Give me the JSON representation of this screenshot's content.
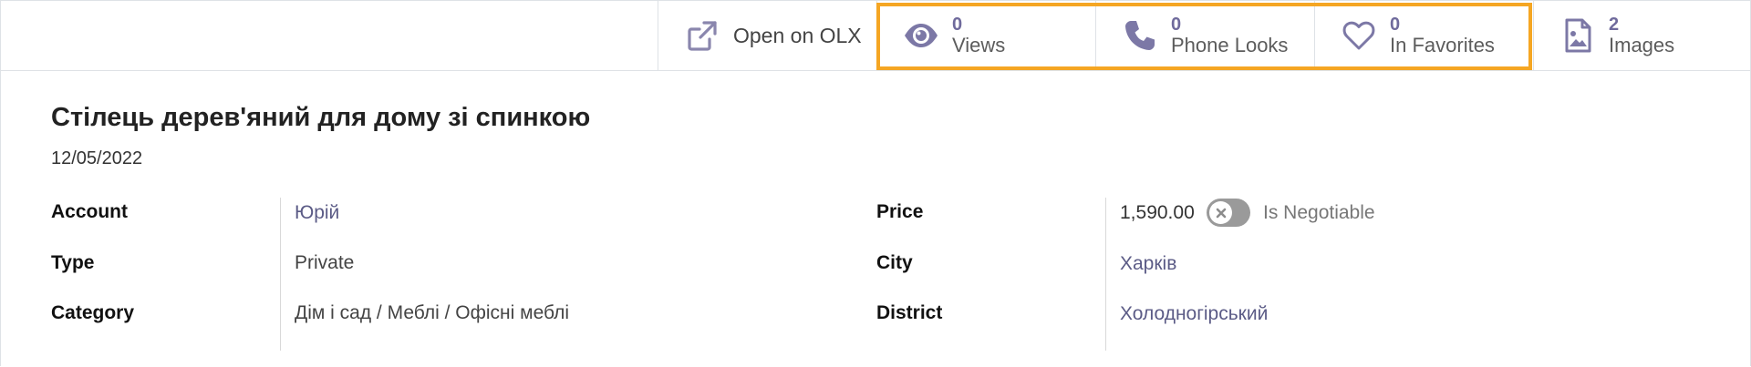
{
  "buttons": {
    "open": {
      "label": "Open on OLX",
      "icon": "external-link-icon"
    },
    "views": {
      "count": "0",
      "label": "Views",
      "icon": "eye-icon"
    },
    "phone": {
      "count": "0",
      "label": "Phone Looks",
      "icon": "phone-icon"
    },
    "favorites": {
      "count": "0",
      "label": "In Favorites",
      "icon": "heart-icon"
    },
    "images": {
      "count": "2",
      "label": "Images",
      "icon": "image-file-icon"
    }
  },
  "highlight_color": "#f5a623",
  "record": {
    "title": "Стілець дерев'яний для дому зі спинкою",
    "date": "12/05/2022"
  },
  "fields_left": {
    "account": {
      "label": "Account",
      "value": "Юрій"
    },
    "type": {
      "label": "Type",
      "value": "Private"
    },
    "category": {
      "label": "Category",
      "value": "Дім і сад / Меблі / Офісні меблі"
    }
  },
  "fields_right": {
    "price": {
      "label": "Price",
      "value": "1,590.00"
    },
    "negotiable": {
      "label": "Is Negotiable",
      "checked": false
    },
    "city": {
      "label": "City",
      "value": "Харків"
    },
    "district": {
      "label": "District",
      "value": "Холодногірський"
    }
  },
  "colors": {
    "link": "#5b5b86",
    "icon": "#6f6a9c",
    "toggle_off": "#9a9a9a"
  }
}
